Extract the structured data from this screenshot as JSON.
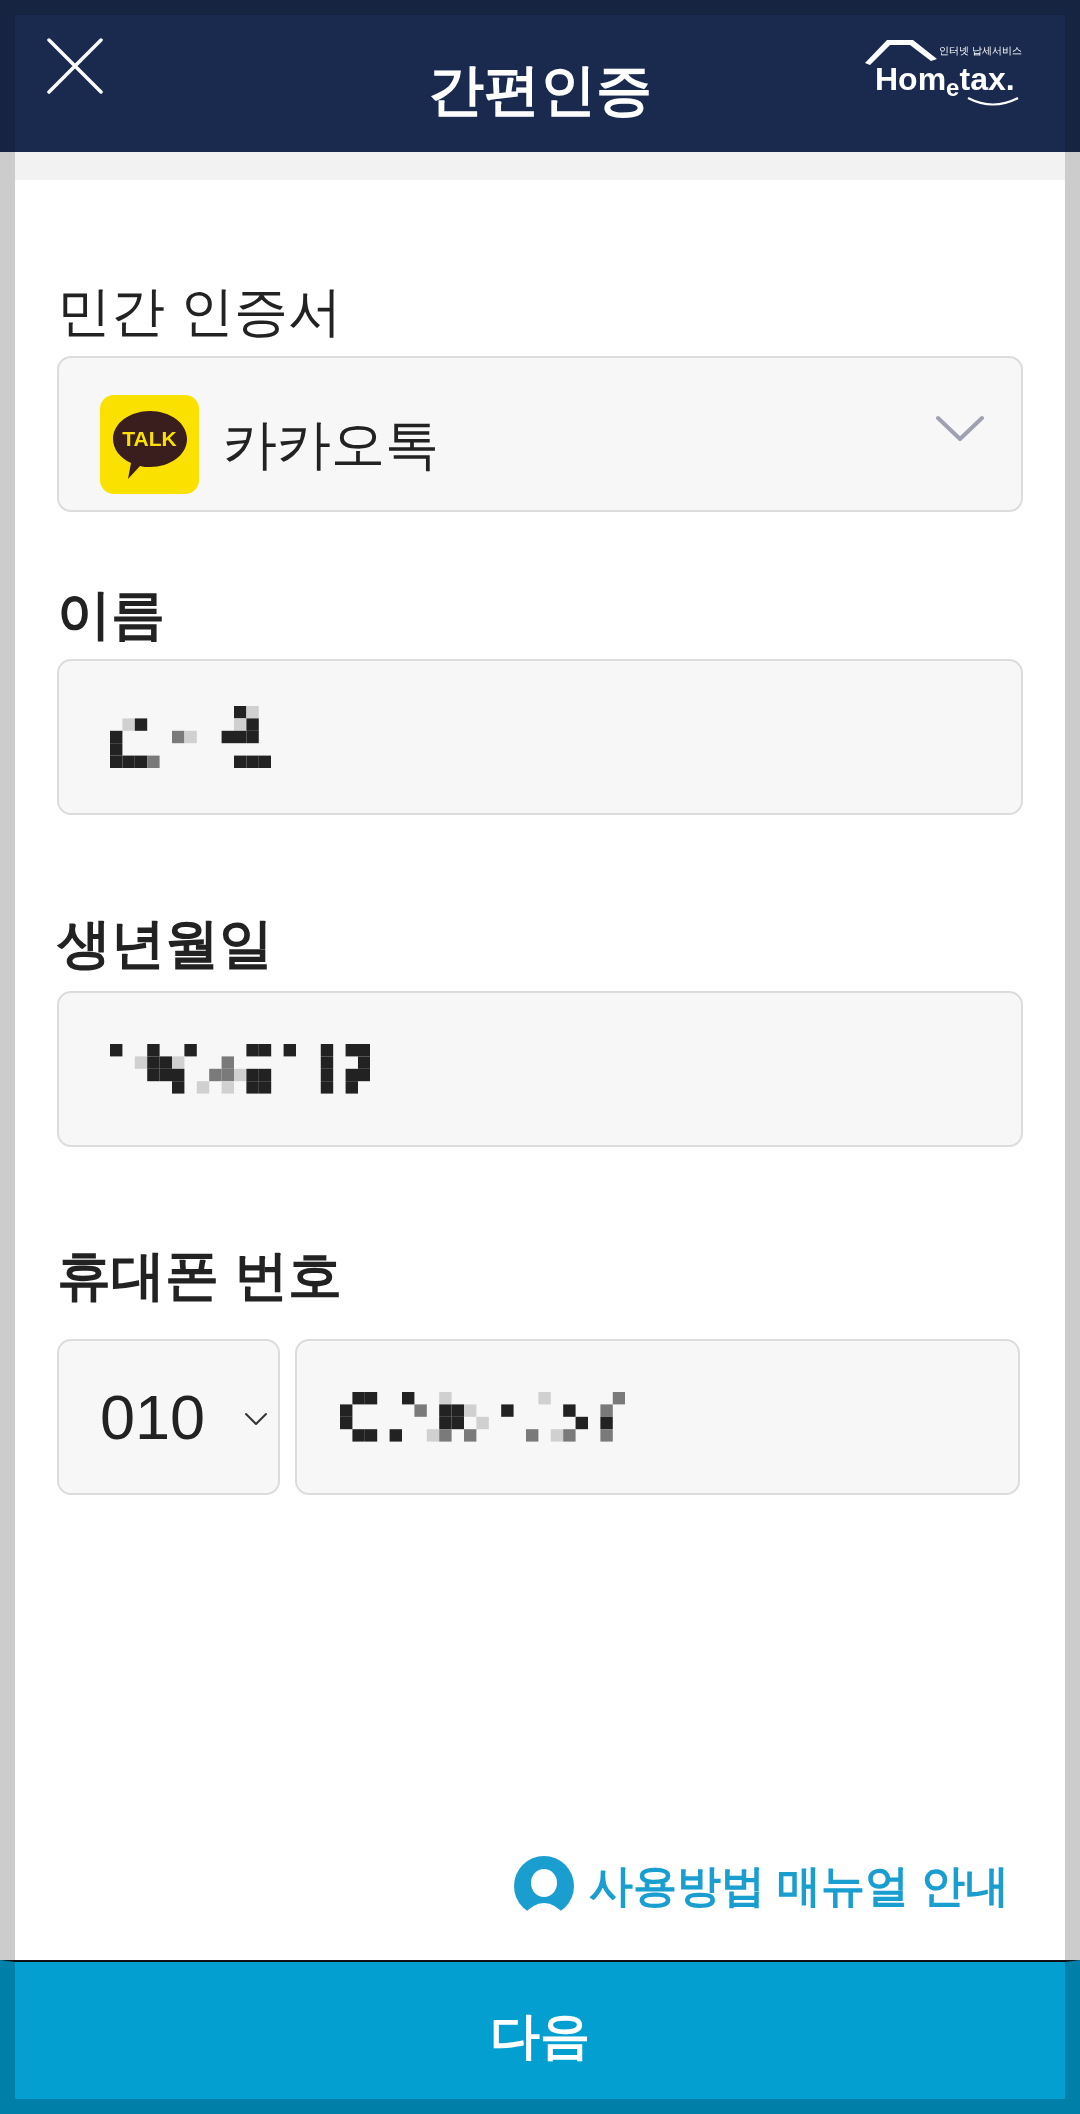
{
  "header": {
    "title": "간편인증",
    "logo": {
      "tagline": "인터넷 납세서비스",
      "wordmark": "Hom$_{e}$tax."
    }
  },
  "fields": [
    {
      "kind": "select",
      "label": "민간 인증서",
      "icon_label": "TALK",
      "value": "카카오톡"
    },
    {
      "kind": "text",
      "label": "이름",
      "redacted": true
    },
    {
      "kind": "text",
      "label": "생년월일",
      "redacted": true
    },
    {
      "kind": "phone",
      "label": "휴대폰 번호",
      "prefix": "010",
      "redacted": true
    }
  ],
  "manual_link": "사용방법 매뉴얼 안내",
  "next_button": "다음"
}
